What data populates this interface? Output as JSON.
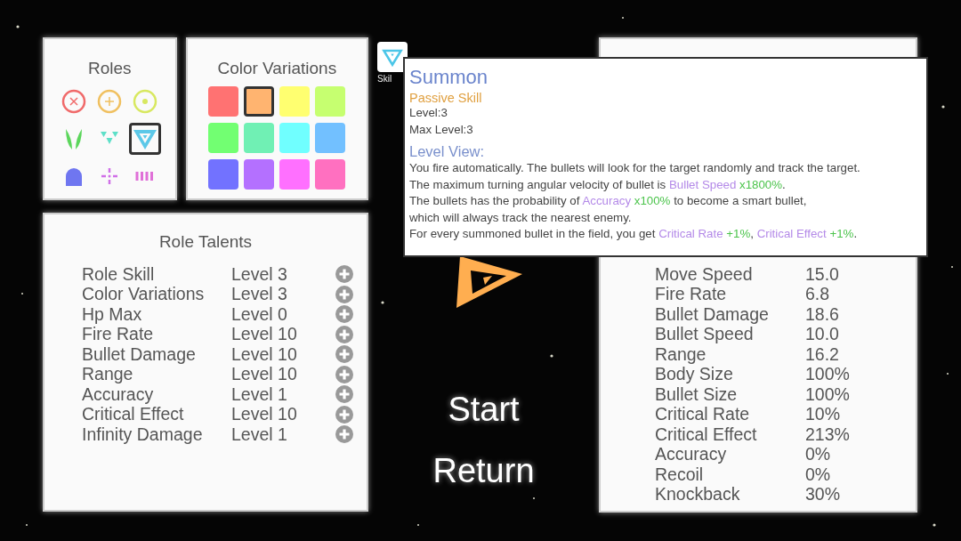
{
  "roles": {
    "title": "Roles",
    "items": [
      {
        "kind": "x-circle",
        "color": "#f06a6a",
        "selected": false
      },
      {
        "kind": "plus-circle",
        "color": "#f0c060",
        "selected": false
      },
      {
        "kind": "dot-circle",
        "color": "#d8e860",
        "selected": false
      },
      {
        "kind": "leaves",
        "color": "#5cd65c",
        "selected": false
      },
      {
        "kind": "triangles",
        "color": "#5ee0c8",
        "selected": false
      },
      {
        "kind": "triangle-target",
        "color": "#5cc8e8",
        "selected": true
      },
      {
        "kind": "dome",
        "color": "#6f76f0",
        "selected": false
      },
      {
        "kind": "crosshair",
        "color": "#d070e8",
        "selected": false
      },
      {
        "kind": "bars",
        "color": "#e070d8",
        "selected": false
      }
    ]
  },
  "color_variations": {
    "title": "Color Variations",
    "swatches": [
      {
        "color": "#ff7272",
        "selected": false
      },
      {
        "color": "#ffb470",
        "selected": true
      },
      {
        "color": "#ffff70",
        "selected": false
      },
      {
        "color": "#c6ff70",
        "selected": false
      },
      {
        "color": "#72ff72",
        "selected": false
      },
      {
        "color": "#70f0b4",
        "selected": false
      },
      {
        "color": "#70ffff",
        "selected": false
      },
      {
        "color": "#72c0ff",
        "selected": false
      },
      {
        "color": "#7272ff",
        "selected": false
      },
      {
        "color": "#b470ff",
        "selected": false
      },
      {
        "color": "#ff70ff",
        "selected": false
      },
      {
        "color": "#ff70c0",
        "selected": false
      }
    ]
  },
  "role_talents": {
    "title": "Role Talents",
    "rows": [
      {
        "name": "Role Skill",
        "level": "Level 3"
      },
      {
        "name": "Color Variations",
        "level": "Level 3"
      },
      {
        "name": "Hp Max",
        "level": "Level 0"
      },
      {
        "name": "Fire Rate",
        "level": "Level 10"
      },
      {
        "name": "Bullet Damage",
        "level": "Level 10"
      },
      {
        "name": "Range",
        "level": "Level 10"
      },
      {
        "name": "Accuracy",
        "level": "Level 1"
      },
      {
        "name": "Critical Effect",
        "level": "Level 10"
      },
      {
        "name": "Infinity Damage",
        "level": "Level 1"
      }
    ]
  },
  "skill_button": {
    "label": "Skil"
  },
  "menu": [
    "Start",
    "Return"
  ],
  "stats": [
    {
      "name": "Move Speed",
      "value": "15.0"
    },
    {
      "name": "Fire Rate",
      "value": "6.8"
    },
    {
      "name": "Bullet Damage",
      "value": "18.6"
    },
    {
      "name": "Bullet Speed",
      "value": "10.0"
    },
    {
      "name": "Range",
      "value": "16.2"
    },
    {
      "name": "Body Size",
      "value": "100%"
    },
    {
      "name": "Bullet Size",
      "value": "100%"
    },
    {
      "name": "Critical Rate",
      "value": "10%"
    },
    {
      "name": "Critical Effect",
      "value": "213%"
    },
    {
      "name": "Accuracy",
      "value": "0%"
    },
    {
      "name": "Recoil",
      "value": "0%"
    },
    {
      "name": "Knockback",
      "value": "30%"
    }
  ],
  "tooltip": {
    "title": "Summon",
    "type": "Passive Skill",
    "level": "Level:3",
    "max_level": "Max Level:3",
    "section": "Level View:",
    "lines": [
      [
        {
          "kind": "plain",
          "text": "You fire automatically. The bullets will look for the target randomly and track the target."
        }
      ],
      [
        {
          "kind": "plain",
          "text": "The maximum turning angular velocity of bullet is "
        },
        {
          "kind": "stat",
          "text": "Bullet Speed"
        },
        {
          "kind": "value",
          "text": " x1800%"
        },
        {
          "kind": "plain",
          "text": "."
        }
      ],
      [
        {
          "kind": "plain",
          "text": "The bullets has the probability of "
        },
        {
          "kind": "stat",
          "text": "Accuracy"
        },
        {
          "kind": "value",
          "text": " x100%"
        },
        {
          "kind": "plain",
          "text": " to become a smart bullet,"
        }
      ],
      [
        {
          "kind": "plain",
          "text": "which will always track the nearest enemy."
        }
      ],
      [
        {
          "kind": "plain",
          "text": "For every summoned bullet in the field, you get "
        },
        {
          "kind": "stat",
          "text": "Critical Rate"
        },
        {
          "kind": "value",
          "text": " +1%"
        },
        {
          "kind": "plain",
          "text": ", "
        },
        {
          "kind": "stat",
          "text": "Critical Effect"
        },
        {
          "kind": "value",
          "text": "  +1%"
        },
        {
          "kind": "plain",
          "text": "."
        }
      ]
    ]
  }
}
